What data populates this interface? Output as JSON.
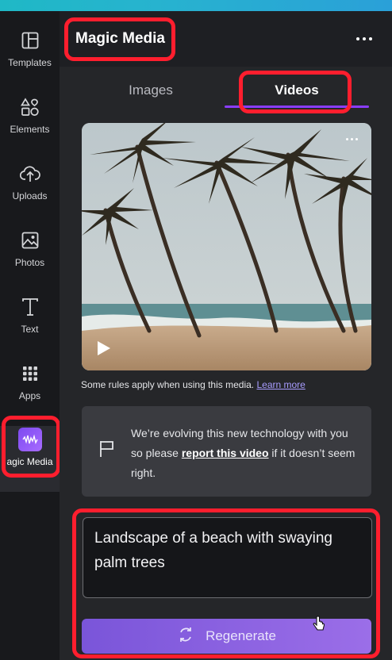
{
  "sidebar": {
    "items": [
      {
        "label": "Templates",
        "icon": "templates-icon"
      },
      {
        "label": "Elements",
        "icon": "elements-icon"
      },
      {
        "label": "Uploads",
        "icon": "uploads-icon"
      },
      {
        "label": "Photos",
        "icon": "photos-icon"
      },
      {
        "label": "Text",
        "icon": "text-icon"
      },
      {
        "label": "Apps",
        "icon": "apps-icon"
      },
      {
        "label": "agic Media",
        "icon": "magic-media-icon",
        "active": true
      }
    ]
  },
  "panel": {
    "title": "Magic Media",
    "tabs": [
      {
        "label": "Images",
        "active": false
      },
      {
        "label": "Videos",
        "active": true
      }
    ],
    "rules_text": "Some rules apply when using this media.",
    "learn_more": "Learn more",
    "notice": {
      "before": "We’re evolving this new technology with you so please ",
      "link": "report this video",
      "after": " if it doesn’t seem right."
    },
    "prompt_value": "Landscape of a beach with swaying palm trees",
    "regenerate_label": "Regenerate"
  },
  "colors": {
    "accent": "#8b3dff",
    "highlight": "#ff1e2e",
    "button": "#7a55d9"
  }
}
